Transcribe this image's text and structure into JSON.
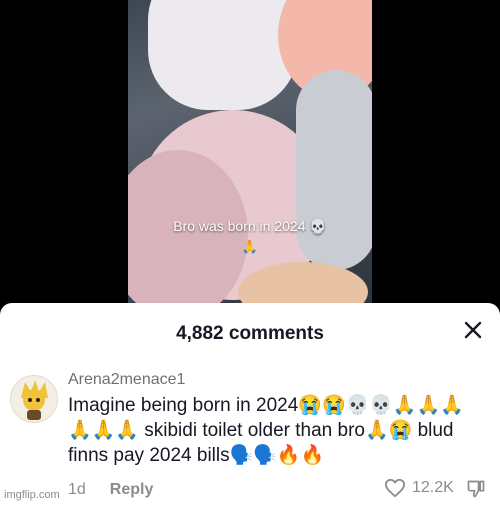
{
  "video": {
    "caption": "Bro was born in 2024 💀",
    "caption_emoji": "🙏"
  },
  "comments_sheet": {
    "title": "4,882 comments",
    "close_icon": "close-icon"
  },
  "comment": {
    "username": "Arena2menace1",
    "text": "Imagine being born in 2024😭😭💀💀🙏🙏🙏 🙏🙏🙏 skibidi toilet older than bro🙏😭 blud finns pay 2024 bills🗣️🗣️🔥🔥",
    "age": "1d",
    "reply_label": "Reply",
    "like_count": "12.2K",
    "like_icon": "heart-icon",
    "dislike_icon": "thumbs-down-icon"
  },
  "watermark": "imgflip.com",
  "colors": {
    "sheet_background": "#ffffff",
    "title_text": "#161823",
    "secondary_text": "#8a8b91"
  }
}
